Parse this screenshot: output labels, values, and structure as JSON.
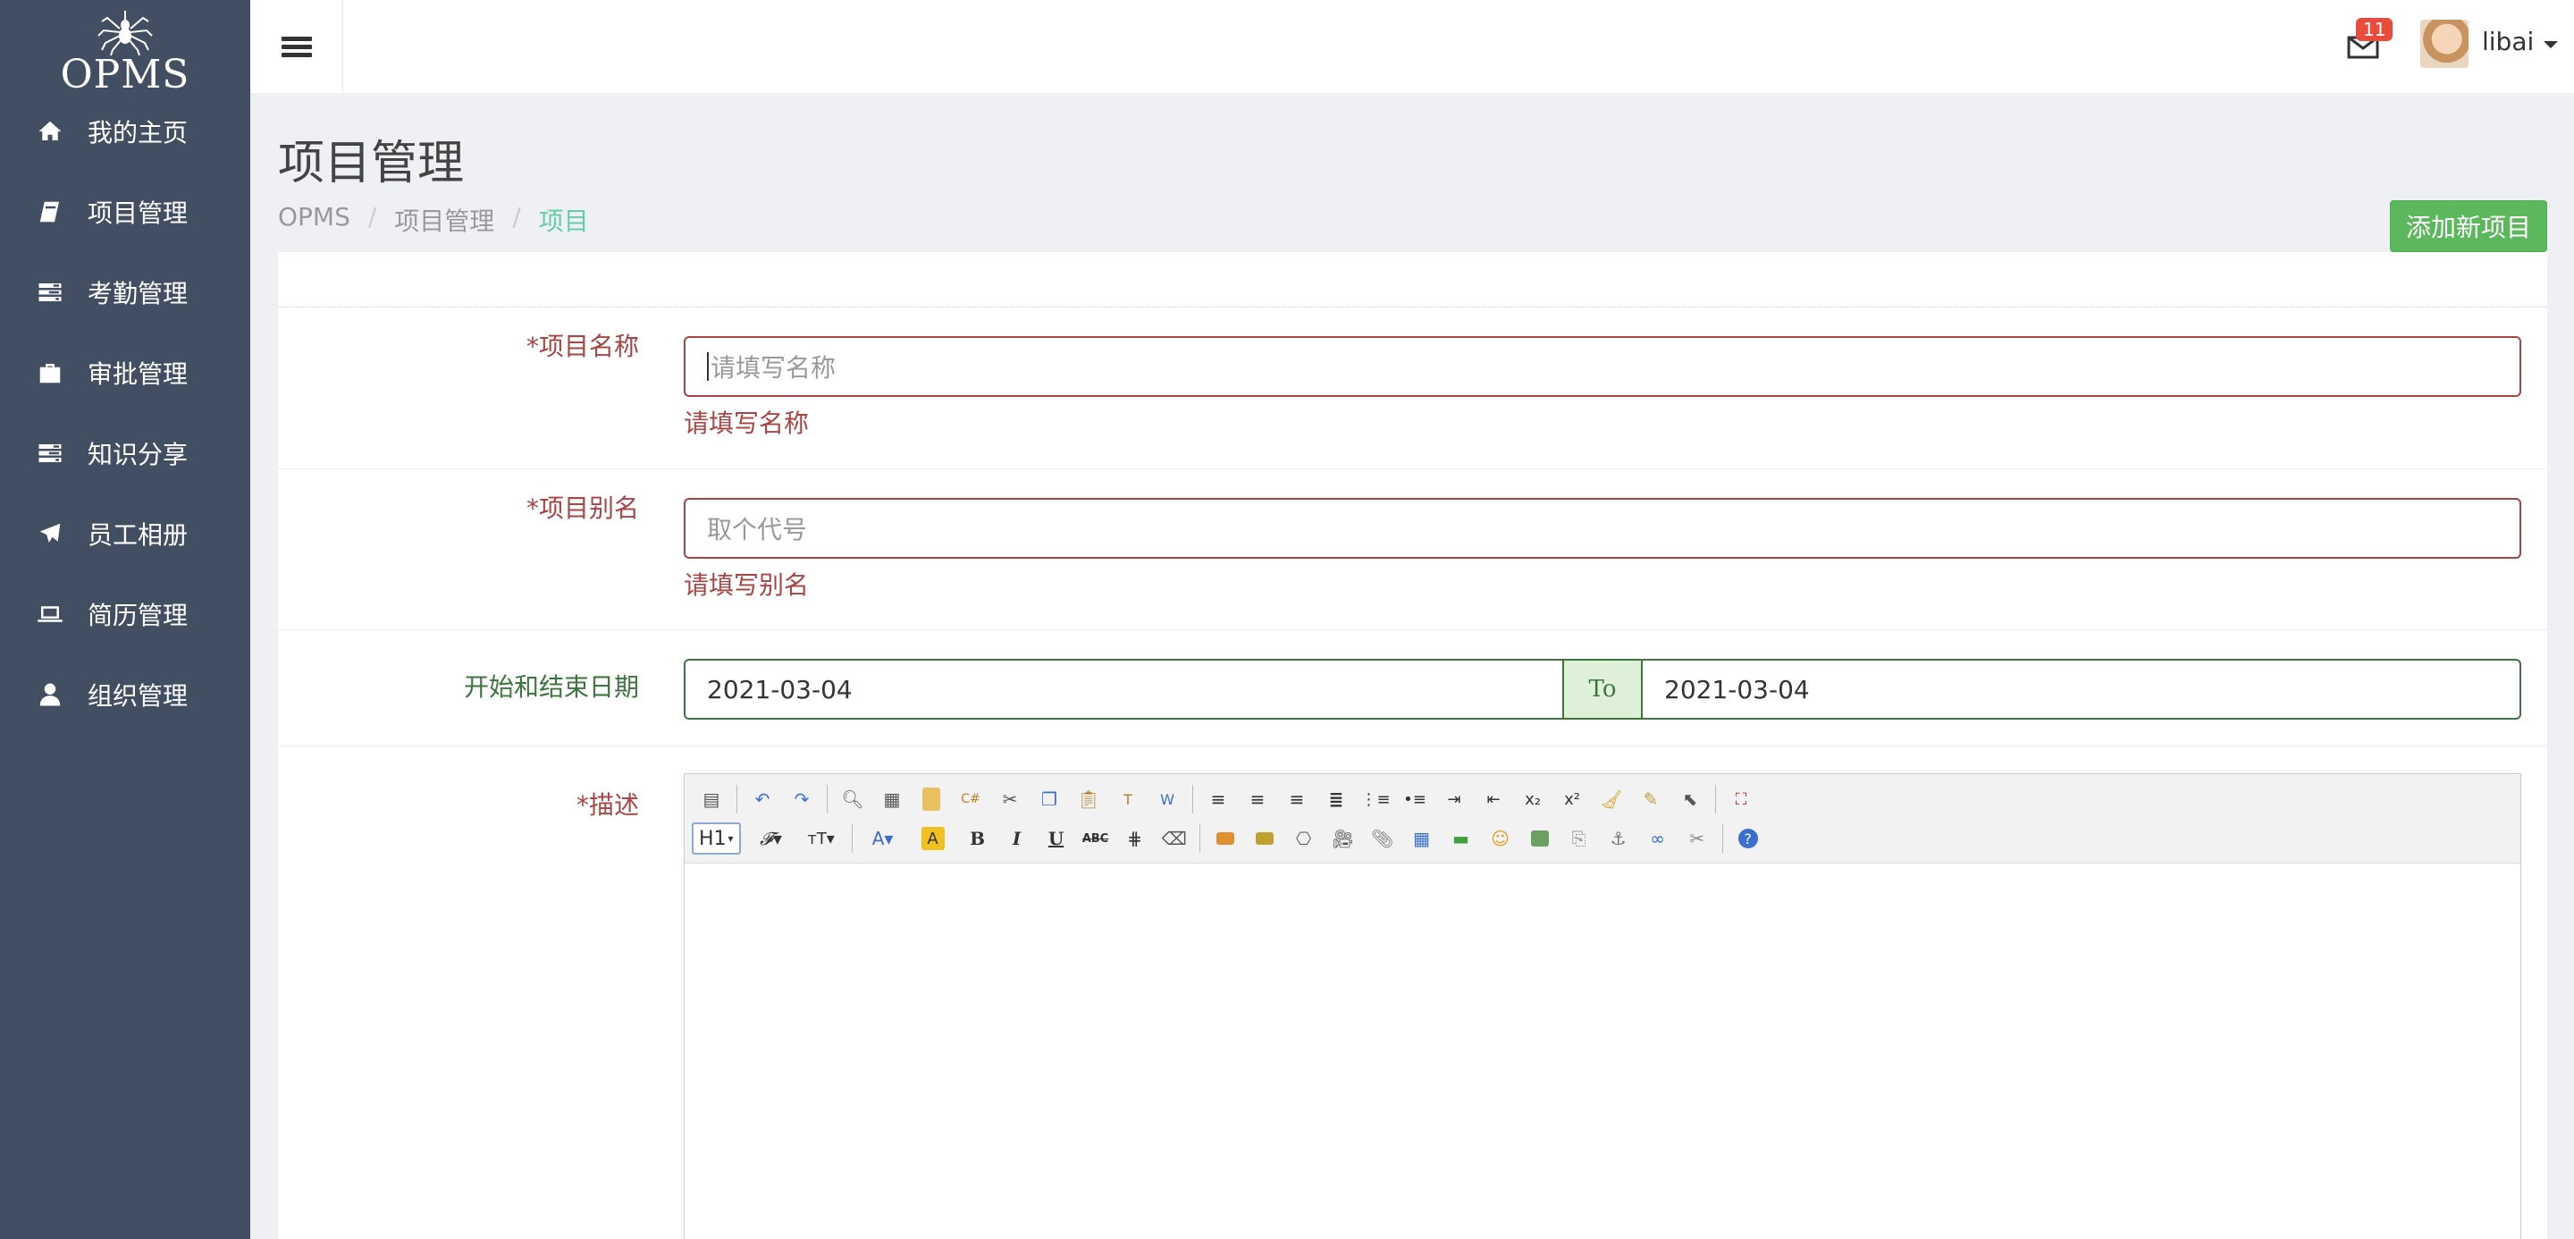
{
  "brand": {
    "logo_text": "OPMS"
  },
  "sidebar": {
    "items": [
      {
        "label": "我的主页",
        "icon": "home-icon"
      },
      {
        "label": "项目管理",
        "icon": "book-icon"
      },
      {
        "label": "考勤管理",
        "icon": "tasks-icon"
      },
      {
        "label": "审批管理",
        "icon": "briefcase-icon"
      },
      {
        "label": "知识分享",
        "icon": "tasks-icon"
      },
      {
        "label": "员工相册",
        "icon": "plane-icon"
      },
      {
        "label": "简历管理",
        "icon": "laptop-icon"
      },
      {
        "label": "组织管理",
        "icon": "user-icon"
      }
    ]
  },
  "header": {
    "mail_count": "11",
    "username": "libai"
  },
  "page": {
    "title": "项目管理",
    "breadcrumb": [
      "OPMS",
      "项目管理",
      "项目"
    ],
    "add_button": "添加新项目"
  },
  "form": {
    "name": {
      "required_mark": "*",
      "label": "项目名称",
      "placeholder": "请填写名称",
      "value": "",
      "error": "请填写名称"
    },
    "alias": {
      "required_mark": "*",
      "label": "项目别名",
      "placeholder": "取个代号",
      "value": "",
      "error": "请填写别名"
    },
    "dates": {
      "label": "开始和结束日期",
      "start": "2021-03-04",
      "separator": "To",
      "end": "2021-03-04"
    },
    "description": {
      "required_mark": "*",
      "label": "描述",
      "heading_select": "H1"
    }
  },
  "colors": {
    "sidebar_bg": "#424f63",
    "page_bg": "#eff0f4",
    "error": "#a94442",
    "success": "#3c763d",
    "breadcrumb_active": "#65cea7",
    "add_button": "#5cb85c",
    "badge": "#e74c3c"
  }
}
